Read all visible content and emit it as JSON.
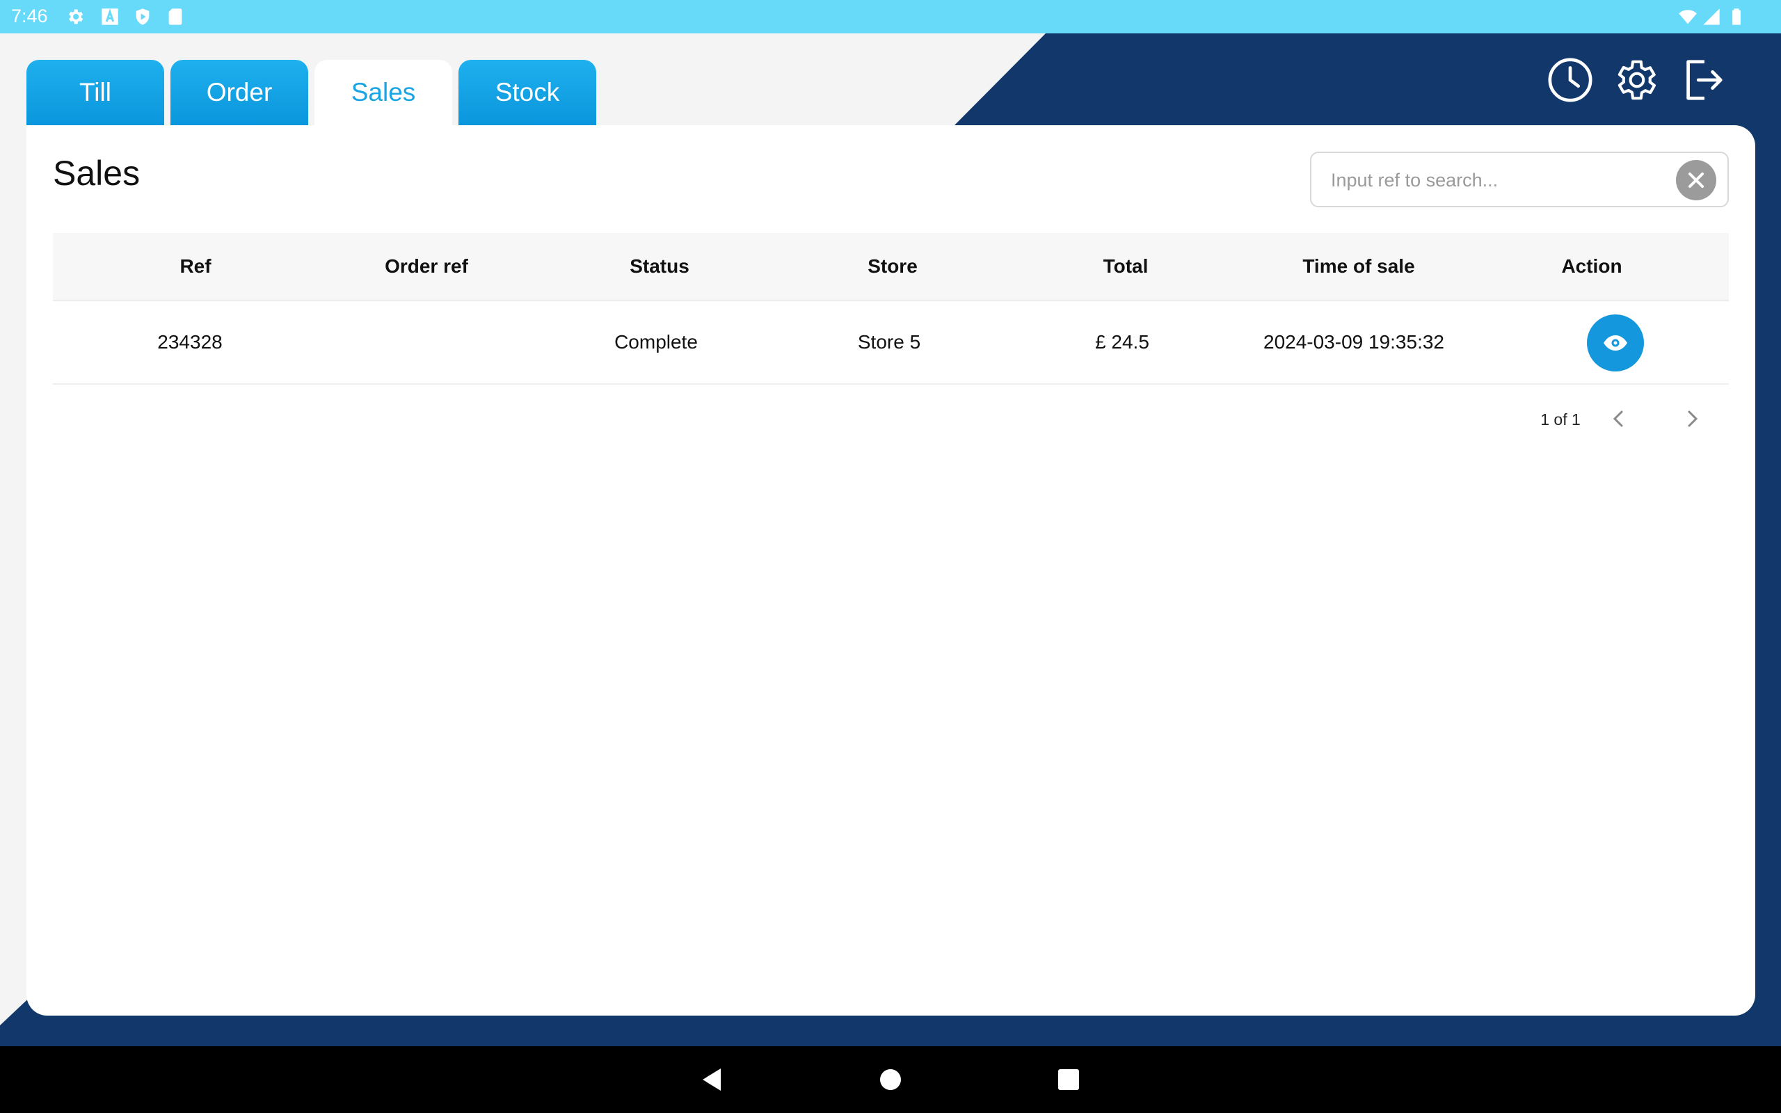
{
  "status_bar": {
    "time": "7:46",
    "left_icons": [
      "settings-icon",
      "a-icon",
      "shield-icon",
      "sd-card-icon"
    ],
    "right_icons": [
      "wifi-icon",
      "signal-icon",
      "battery-icon"
    ]
  },
  "tabs": [
    {
      "label": "Till",
      "active": false
    },
    {
      "label": "Order",
      "active": false
    },
    {
      "label": "Sales",
      "active": true
    },
    {
      "label": "Stock",
      "active": false
    }
  ],
  "header_icons": [
    "clock-icon",
    "gear-icon",
    "logout-icon"
  ],
  "page": {
    "title": "Sales"
  },
  "search": {
    "placeholder": "Input ref to search...",
    "value": ""
  },
  "table": {
    "columns": [
      "Ref",
      "Order ref",
      "Status",
      "Store",
      "Total",
      "Time of sale",
      "Action"
    ],
    "rows": [
      {
        "ref": "234328",
        "order_ref": "",
        "status": "Complete",
        "store": "Store 5",
        "total": "£ 24.5",
        "time_of_sale": "2024-03-09 19:35:32",
        "action": "view-icon"
      }
    ]
  },
  "pagination": {
    "text": "1 of 1"
  },
  "nav_bar": [
    "back-icon",
    "home-icon",
    "recents-icon"
  ],
  "colors": {
    "status_bar": "#67d9f9",
    "navy": "#12386b",
    "tab_blue": "#0a96dc",
    "accent": "#1aa4e4"
  }
}
